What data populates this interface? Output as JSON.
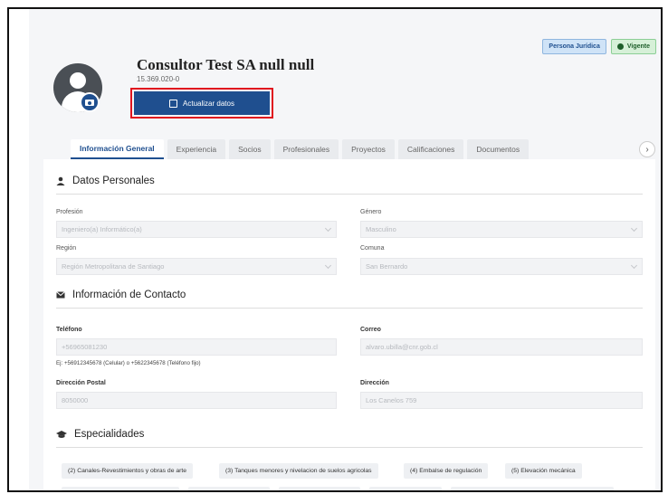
{
  "header": {
    "title": "Consultor Test SA null null",
    "rut": "15.369.020-0",
    "update_button": "Actualizar datos",
    "badges": [
      "Persona Jurídica",
      "Vigente"
    ]
  },
  "tabs": [
    "Información General",
    "Experiencia",
    "Socios",
    "Profesionales",
    "Proyectos",
    "Calificaciones",
    "Documentos"
  ],
  "datos_personales": {
    "heading": "Datos Personales",
    "profesion_label": "Profesión",
    "profesion_value": "Ingeniero(a) Informático(a)",
    "genero_label": "Género",
    "genero_value": "Masculino",
    "region_label": "Región",
    "region_value": "Región Metropolitana de Santiago",
    "comuna_label": "Comuna",
    "comuna_value": "San Bernardo"
  },
  "contacto": {
    "heading": "Información de Contacto",
    "telefono_label": "Teléfono",
    "telefono_value": "+56965081230",
    "telefono_hint": "Ej: +56912345678 (Celular) o +5622345678 (Teléfono fijo)",
    "correo_label": "Correo",
    "correo_value": "alvaro.ubilla@cnr.gob.cl",
    "postal_label": "Dirección Postal",
    "postal_value": "8050000",
    "direccion_label": "Dirección",
    "direccion_value": "Los Canelos 759"
  },
  "especialidades": {
    "heading": "Especialidades",
    "chips": [
      "(2) Canales-Revestimientos y obras de arte",
      "(3) Tanques menores y nivelacion de suelos agricolas",
      "(4) Embalse de regulación",
      "(5) Elevación mecánica"
    ]
  }
}
